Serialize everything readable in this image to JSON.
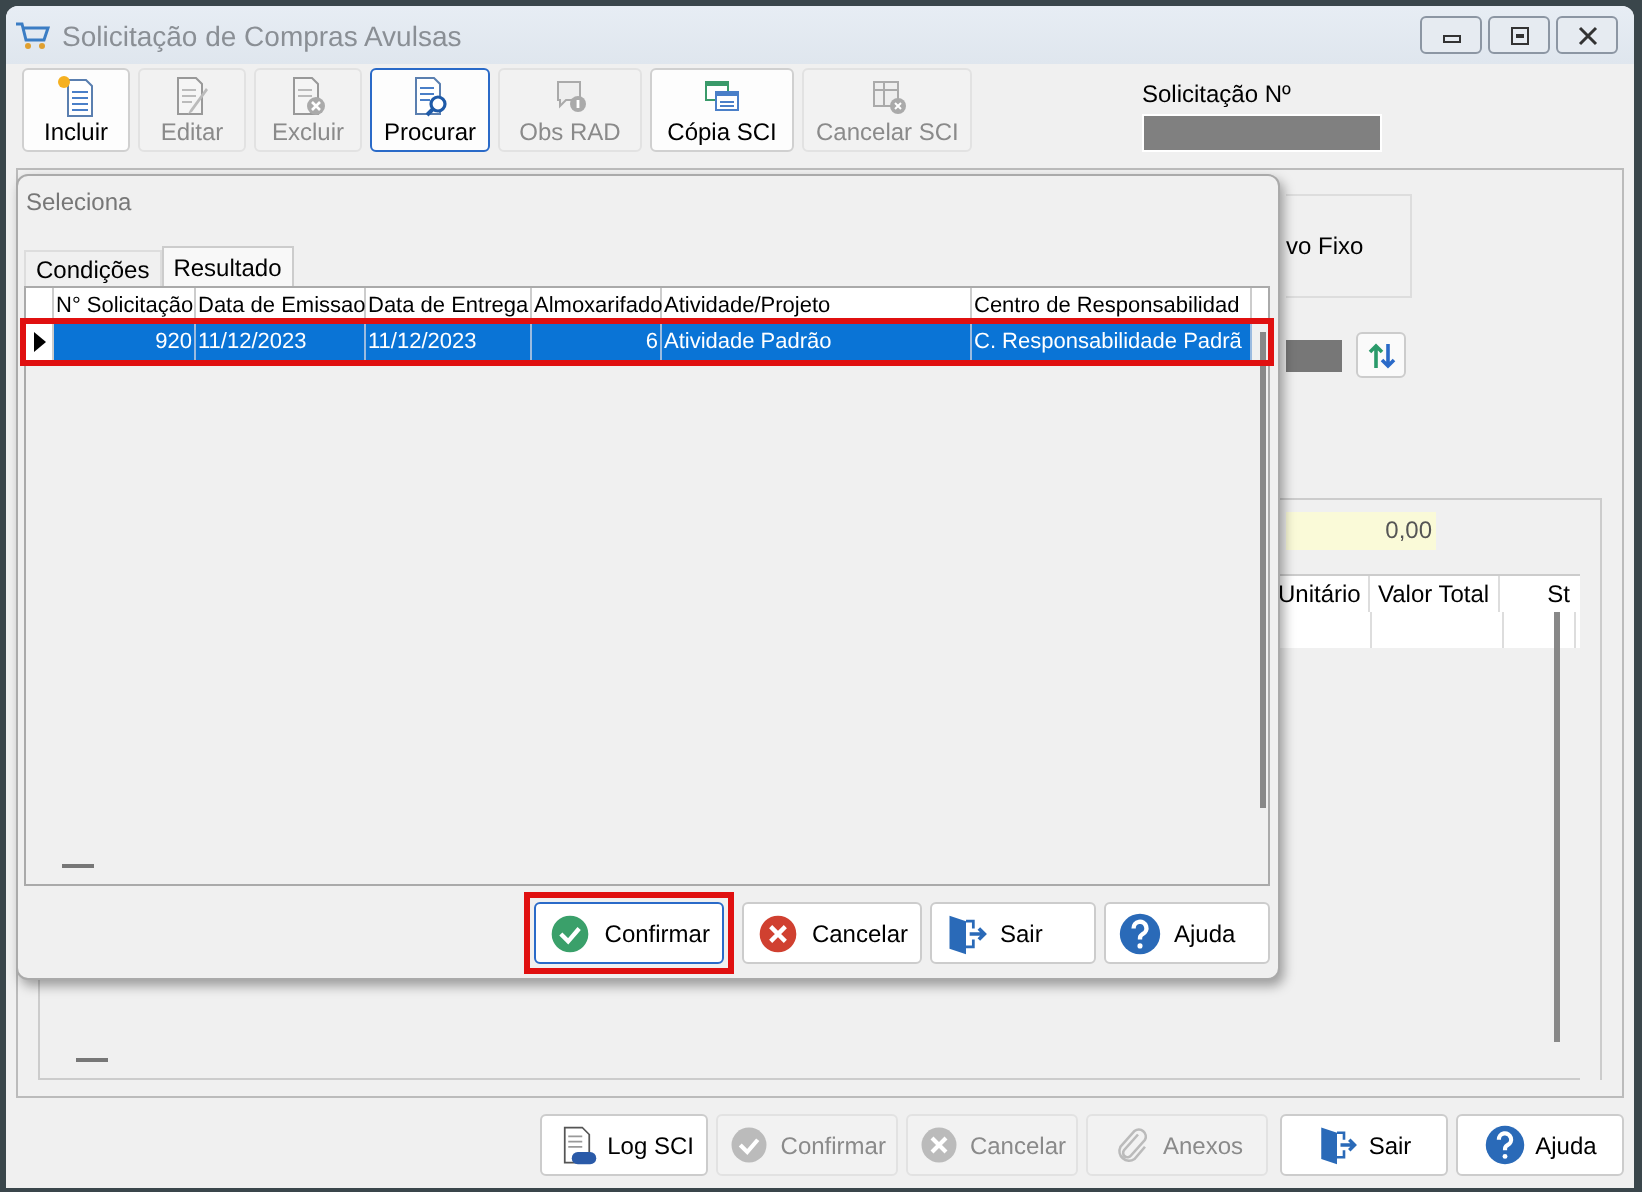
{
  "window": {
    "title": "Solicitação de Compras Avulsas"
  },
  "toolbar": [
    {
      "label": "Incluir",
      "kind": "new",
      "enabled": true,
      "focused": false
    },
    {
      "label": "Editar",
      "kind": "edit",
      "enabled": false,
      "focused": false
    },
    {
      "label": "Excluir",
      "kind": "delete",
      "enabled": false,
      "focused": false
    },
    {
      "label": "Procurar",
      "kind": "search",
      "enabled": true,
      "focused": true
    },
    {
      "label": "Obs RAD",
      "kind": "note",
      "enabled": false,
      "focused": false
    },
    {
      "label": "Cópia SCI",
      "kind": "copy",
      "enabled": true,
      "focused": false
    },
    {
      "label": "Cancelar SCI",
      "kind": "cancel",
      "enabled": false,
      "focused": false
    }
  ],
  "request_number": {
    "label": "Solicitação Nº"
  },
  "background_panel": {
    "option_label": "vo Fixo",
    "total_value": "0,00",
    "items_columns": [
      "Unitário",
      "Valor Total",
      "St"
    ]
  },
  "dialog": {
    "title": "Seleciona",
    "tabs": [
      {
        "label": "Condições",
        "selected": false
      },
      {
        "label": "Resultado",
        "selected": true
      }
    ],
    "columns": [
      {
        "label": "N° Solicitação",
        "numeric": true
      },
      {
        "label": "Data de Emissao",
        "numeric": false
      },
      {
        "label": "Data de Entrega",
        "numeric": false
      },
      {
        "label": "Almoxarifado",
        "numeric": true
      },
      {
        "label": "Atividade/Projeto",
        "numeric": false
      },
      {
        "label": "Centro de Responsabilidad",
        "numeric": false
      }
    ],
    "rows": [
      {
        "cells": [
          "920",
          "11/12/2023",
          "11/12/2023",
          "6",
          "Atividade Padrão",
          "C. Responsabilidade Padrã"
        ],
        "selected": true,
        "highlighted": true
      }
    ],
    "buttons": [
      {
        "label": "Confirmar",
        "kind": "confirm",
        "focused": true,
        "highlighted": true
      },
      {
        "label": "Cancelar",
        "kind": "cancel",
        "focused": false,
        "highlighted": false
      },
      {
        "label": "Sair",
        "kind": "exit",
        "focused": false,
        "highlighted": false
      },
      {
        "label": "Ajuda",
        "kind": "help",
        "focused": false,
        "highlighted": false
      }
    ]
  },
  "footer_buttons": [
    {
      "label": "Log SCI",
      "kind": "log",
      "enabled": true
    },
    {
      "label": "Confirmar",
      "kind": "confirm",
      "enabled": false
    },
    {
      "label": "Cancelar",
      "kind": "cancel",
      "enabled": false
    },
    {
      "label": "Anexos",
      "kind": "attach",
      "enabled": false
    },
    {
      "label": "Sair",
      "kind": "exit",
      "enabled": true
    },
    {
      "label": "Ajuda",
      "kind": "help",
      "enabled": true
    }
  ]
}
